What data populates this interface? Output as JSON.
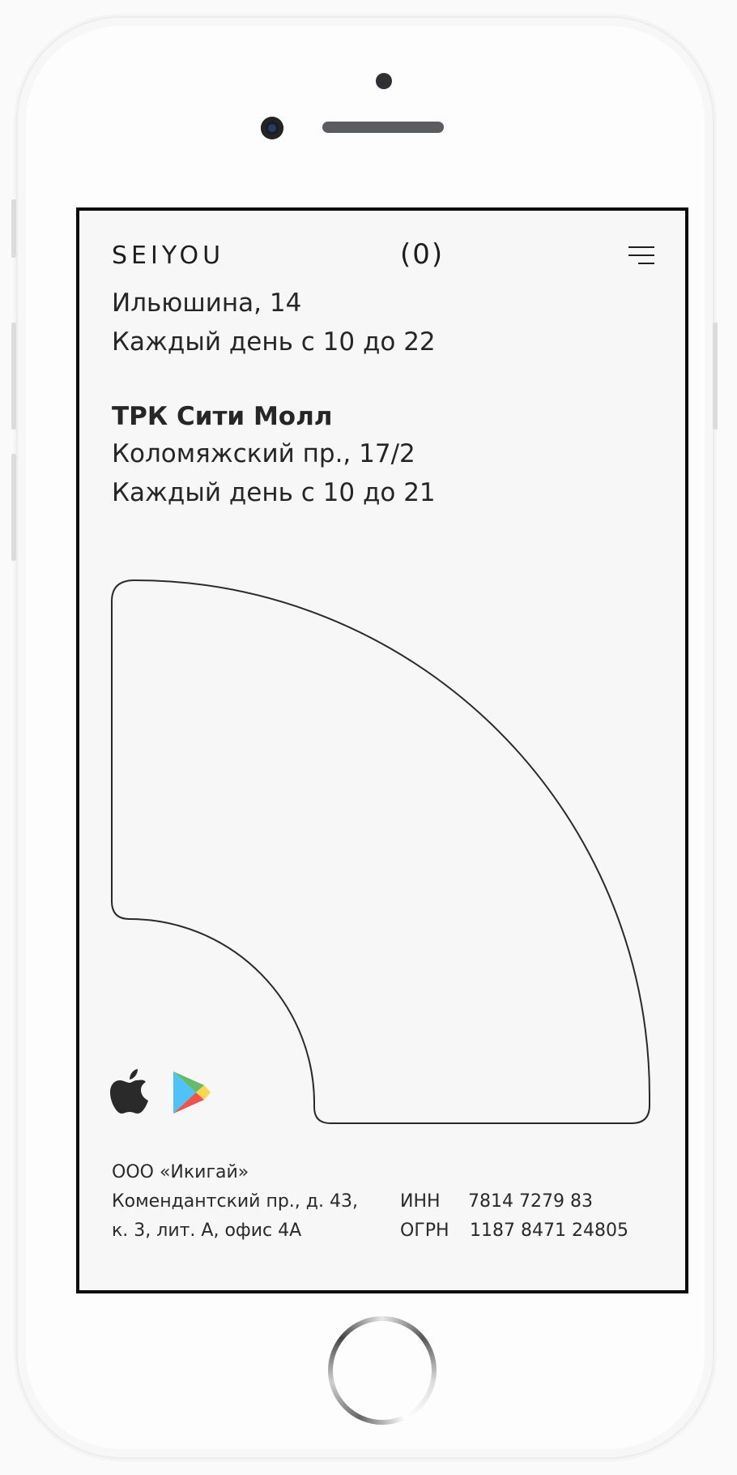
{
  "header": {
    "logo": "SEIYOU",
    "cart": "(0)"
  },
  "stores": [
    {
      "name": "",
      "address": "Ильюшина, 14",
      "hours": "Каждый день с 10 до 22"
    },
    {
      "name": "ТРК Сити Молл",
      "address": "Коломяжский пр., 17/2",
      "hours": "Каждый день с 10 до 21"
    }
  ],
  "footer": {
    "company": "ООО «Икигай»",
    "address_line1": "Комендантский пр., д. 43,",
    "address_line2": "к. 3, лит. А, офис 4А",
    "inn_label": "ИНН",
    "inn_value": "7814 7279 83",
    "ogrn_label": "ОГРН",
    "ogrn_value": "1187 8471 24805"
  },
  "icons": {
    "apple": "apple-icon",
    "google_play": "google-play-icon",
    "menu": "hamburger-menu-icon"
  }
}
